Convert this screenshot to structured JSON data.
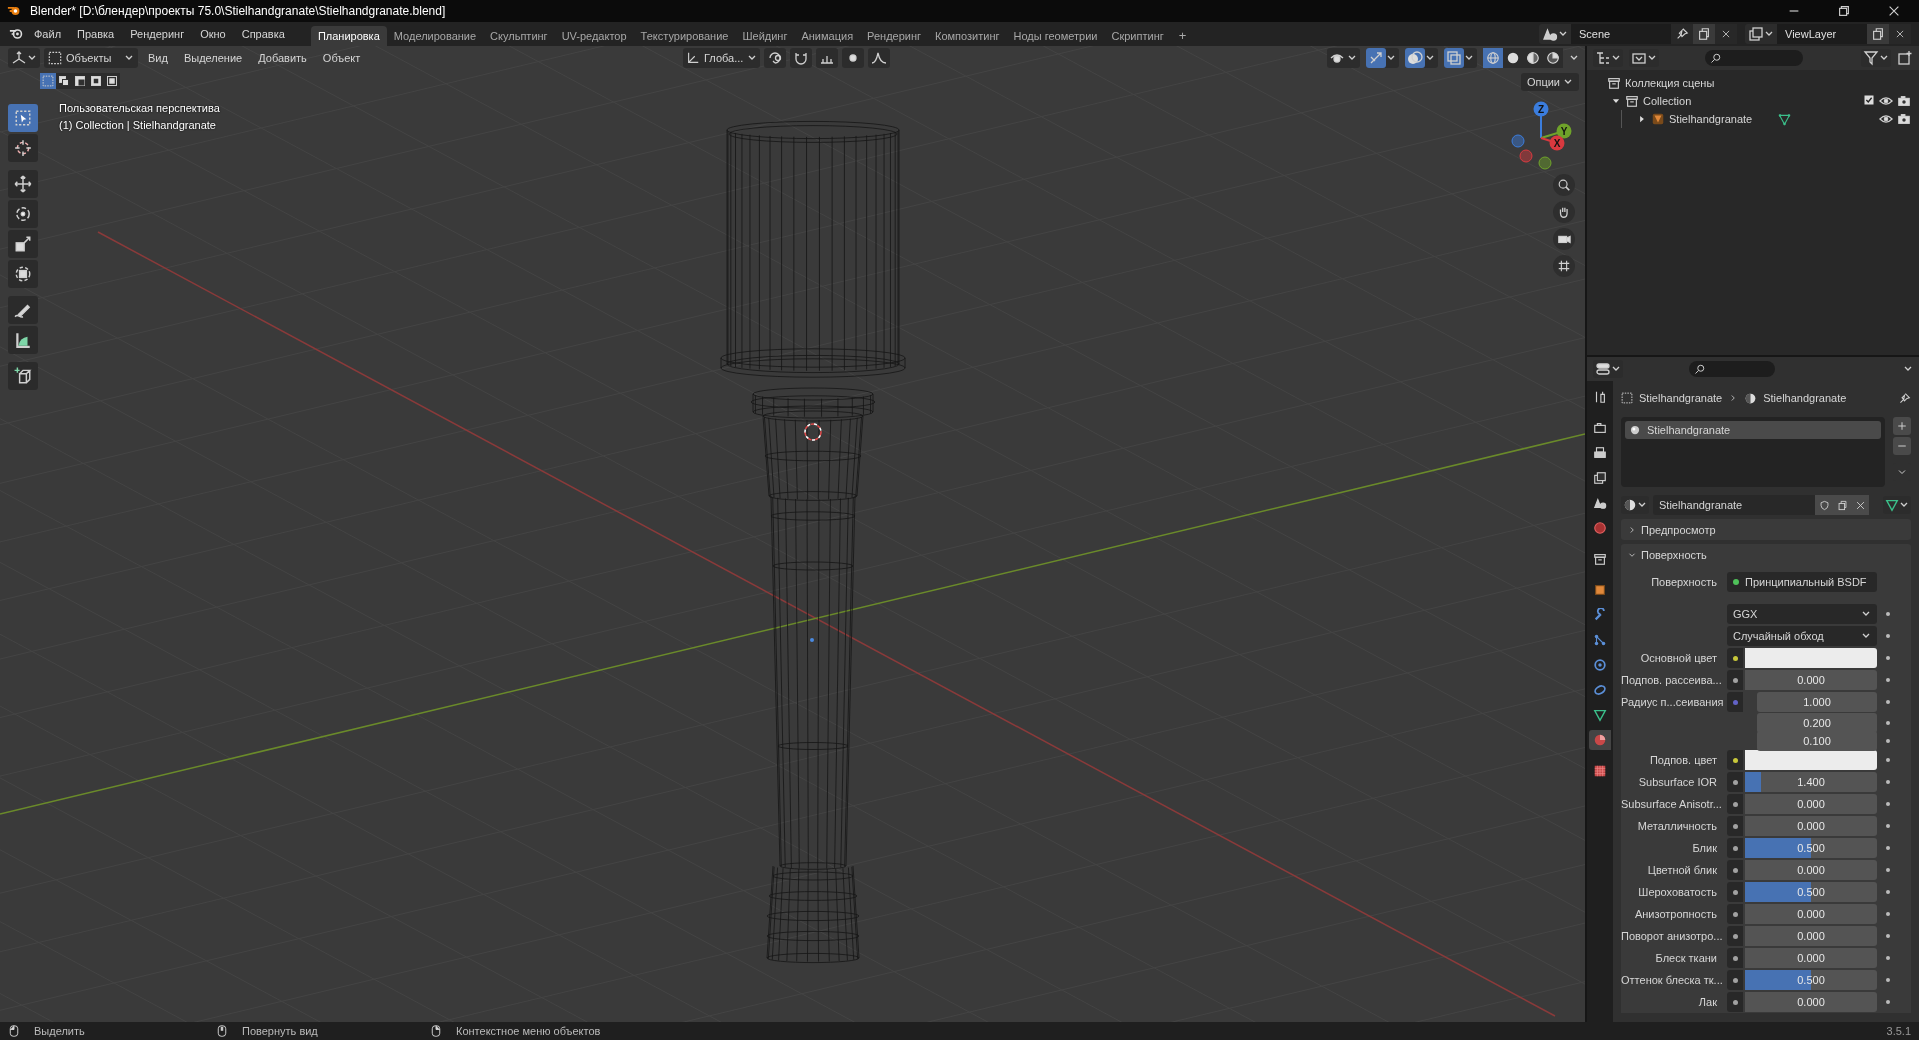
{
  "window": {
    "title": "Blender* [D:\\блендер\\проекты 75.0\\Stielhandgranate\\Stielhandgranate.blend]"
  },
  "menu": [
    "Файл",
    "Правка",
    "Рендеринг",
    "Окно",
    "Справка"
  ],
  "workspaces": [
    {
      "label": "Планировка",
      "selected": true
    },
    {
      "label": "Моделирование",
      "selected": false
    },
    {
      "label": "Скульптинг",
      "selected": false
    },
    {
      "label": "UV-редактор",
      "selected": false
    },
    {
      "label": "Текстурирование",
      "selected": false
    },
    {
      "label": "Шейдинг",
      "selected": false
    },
    {
      "label": "Анимация",
      "selected": false
    },
    {
      "label": "Рендеринг",
      "selected": false
    },
    {
      "label": "Композитинг",
      "selected": false
    },
    {
      "label": "Ноды геометрии",
      "selected": false
    },
    {
      "label": "Скриптинг",
      "selected": false
    }
  ],
  "workspace_add": "+",
  "scene": "Scene",
  "view_layer": "ViewLayer",
  "viewport": {
    "mode": "Объекты",
    "menus": [
      "Вид",
      "Выделение",
      "Добавить",
      "Объект"
    ],
    "orientation": "Глоба...",
    "options": "Опции",
    "select_modes": [
      {
        "selected": true
      },
      {
        "selected": false
      },
      {
        "selected": false
      },
      {
        "selected": false
      },
      {
        "selected": false
      }
    ],
    "toggles": [
      {
        "kind": "visibility",
        "on": false
      },
      {
        "kind": "gizmo",
        "on": true
      },
      {
        "kind": "overlay",
        "on": true
      },
      {
        "kind": "xray",
        "on": true
      }
    ],
    "shading": [
      {
        "kind": "wireframe",
        "selected": true
      },
      {
        "kind": "solid",
        "selected": false
      },
      {
        "kind": "material",
        "selected": false
      },
      {
        "kind": "rendered",
        "selected": false
      }
    ],
    "view_name": "Пользовательская перспектива",
    "context": "(1) Collection | Stielhandgranate",
    "tools": [
      {
        "kind": "select",
        "selected": true
      },
      {
        "kind": "cursor",
        "selected": false
      },
      {
        "kind": "move",
        "selected": false
      },
      {
        "kind": "rotate",
        "selected": false
      },
      {
        "kind": "scale",
        "selected": false
      },
      {
        "kind": "transform",
        "selected": false
      },
      {
        "kind": "annotate",
        "selected": false
      },
      {
        "kind": "measure",
        "selected": false
      },
      {
        "kind": "add_cube",
        "selected": false
      }
    ],
    "gizmo_axes": [
      "Z",
      "Y",
      "X"
    ]
  },
  "outliner": {
    "root": "Коллекция сцены",
    "items": [
      {
        "name": "Collection",
        "kind": "collection",
        "expanded": true,
        "children": [
          {
            "name": "Stielhandgranate",
            "kind": "object",
            "expanded": false
          }
        ]
      }
    ]
  },
  "properties": {
    "tabs": [
      {
        "kind": "tool",
        "selected": false
      },
      {
        "kind": "render",
        "selected": false
      },
      {
        "kind": "output",
        "selected": false
      },
      {
        "kind": "view_layer",
        "selected": false
      },
      {
        "kind": "scene",
        "selected": false
      },
      {
        "kind": "world",
        "selected": false
      },
      {
        "kind": "collection",
        "selected": false
      },
      {
        "kind": "object",
        "selected": false
      },
      {
        "kind": "modifiers",
        "selected": false
      },
      {
        "kind": "particles",
        "selected": false
      },
      {
        "kind": "physics",
        "selected": false
      },
      {
        "kind": "constraints",
        "selected": false
      },
      {
        "kind": "data",
        "selected": false
      },
      {
        "kind": "material",
        "selected": true
      },
      {
        "kind": "texture",
        "selected": false
      }
    ],
    "breadcrumb": [
      "Stielhandgranate",
      "Stielhandgranate"
    ],
    "slots": [
      {
        "name": "Stielhandgranate",
        "selected": true
      }
    ],
    "material": "Stielhandgranate",
    "panels": [
      {
        "title": "Предпросмотр",
        "expanded": false
      },
      {
        "title": "Поверхность",
        "expanded": true,
        "rows": [
          {
            "kind": "shader",
            "label": "Поверхность",
            "value": "Принципиальный BSDF"
          },
          {
            "kind": "dropdown",
            "value": "GGX"
          },
          {
            "kind": "dropdown",
            "value": "Случайный обход"
          },
          {
            "kind": "color",
            "label": "Основной цвет"
          },
          {
            "kind": "slider",
            "label": "Подпов. рассеива...",
            "value": "0.000",
            "level": 0
          },
          {
            "kind": "vector",
            "label": "Радиус п...сеивания",
            "values": [
              "1.000",
              "0.200",
              "0.100"
            ]
          },
          {
            "kind": "color",
            "label": "Подпов. цвет"
          },
          {
            "kind": "slider",
            "label": "Subsurface IOR",
            "value": "1.400",
            "level": 0.12
          },
          {
            "kind": "slider",
            "label": "Subsurface Anisotr...",
            "value": "0.000",
            "level": 0
          },
          {
            "kind": "slider",
            "label": "Металличность",
            "value": "0.000",
            "level": 0
          },
          {
            "kind": "slider",
            "label": "Блик",
            "value": "0.500",
            "level": 0.5
          },
          {
            "kind": "slider",
            "label": "Цветной блик",
            "value": "0.000",
            "level": 0
          },
          {
            "kind": "slider",
            "label": "Шероховатость",
            "value": "0.500",
            "level": 0.5
          },
          {
            "kind": "slider",
            "label": "Анизотропность",
            "value": "0.000",
            "level": 0
          },
          {
            "kind": "slider",
            "label": "Поворот анизотро...",
            "value": "0.000",
            "level": 0
          },
          {
            "kind": "slider",
            "label": "Блеск ткани",
            "value": "0.000",
            "level": 0
          },
          {
            "kind": "slider",
            "label": "Оттенок блеска тк...",
            "value": "0.500",
            "level": 0.5
          },
          {
            "kind": "slider",
            "label": "Лак",
            "value": "0.000",
            "level": 0
          }
        ]
      }
    ]
  },
  "version": "3.5.1",
  "status_bar": [
    "Выделить",
    "Повернуть вид",
    "Контекстное меню объектов"
  ]
}
